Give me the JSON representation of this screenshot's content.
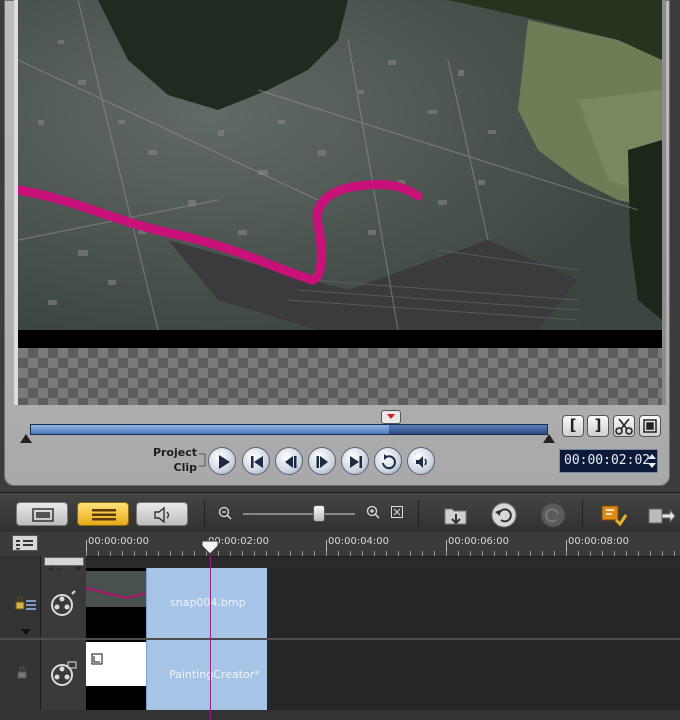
{
  "preview": {
    "mode_labels": {
      "project": "Project",
      "clip": "Clip"
    },
    "timecode": "00:00:02:02",
    "scrub_progress_fraction": 0.69,
    "buttons": {
      "mark_in": "[",
      "mark_out": "]"
    }
  },
  "toolbar": {
    "view_buttons": [
      "storyboard-view",
      "timeline-view",
      "audio-view"
    ],
    "active_view": "timeline-view",
    "zoom_level_fraction": 0.68
  },
  "ruler": {
    "labels": [
      "00:00:00:00",
      "00:00:02:00",
      "00:00:04:00",
      "00:00:06:00",
      "00:00:08:00"
    ]
  },
  "tracks": [
    {
      "name": "video",
      "clip_label": "snap004.bmp"
    },
    {
      "name": "overlay",
      "clip_label": "PaintingCreator*"
    }
  ],
  "colors": {
    "clip_fill": "#a6c4e6",
    "path_stroke": "#c8127a",
    "timeline_view_active": "#f3c23a"
  }
}
